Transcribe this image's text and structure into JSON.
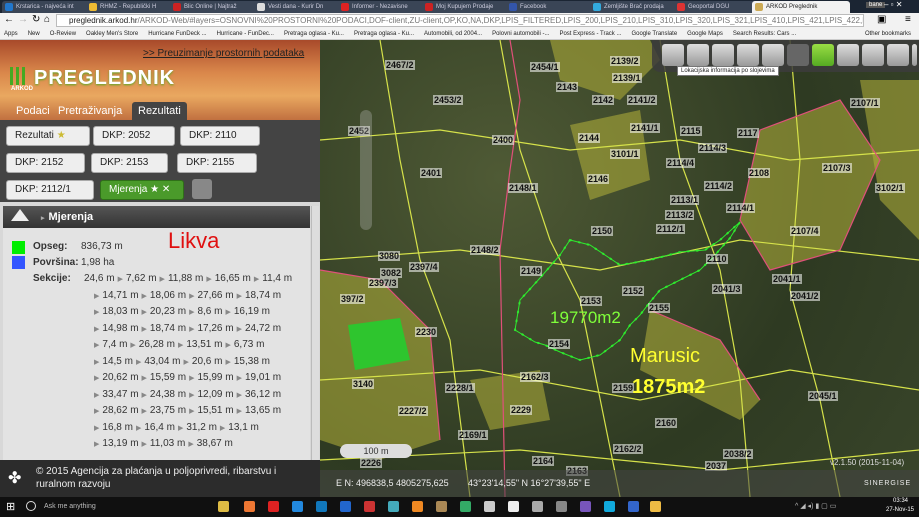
{
  "browser": {
    "tabs": [
      "Krstarica - najveća int",
      "RHMZ - Republički H",
      "Blic Online | Najtraž",
      "Vesti dana - Kurir Dn",
      "Informer - Nezavisne",
      "Moj Kupujem Prodaje",
      "Facebook",
      "Zemljište Brač prodaja",
      "Geoportal DGU",
      "ARKOD Preglednik"
    ],
    "user": "bane",
    "url_host": "preglednik.arkod.hr",
    "url_rest": "/ARKOD-Web/#layers=OSNOVNI%20PROSTORNI%20PODACI,DOF-client,ZU-client,OP,KO,NA,DKP,LPIS_FILTERED,LPIS_200,LPIS_210,LPIS_310,LPIS_320,LPIS_321,LPIS_410,LPIS_421,LPIS_422,LPIS_430,LPIS_450,LPIS_490,LI",
    "bookmarks": [
      "Apps",
      "New",
      "O-Review",
      "Oakley Men's Store",
      "Hurricane FunDeck ...",
      "Hurricane - FunDec...",
      "Pretraga oglasa - Ku...",
      "Pretraga oglasa - Ku...",
      "Automobili, od 2004...",
      "Polovni automobili -...",
      "Post Express - Track ...",
      "Google Translate",
      "Google Maps",
      "Search Results: Cars ...",
      "Other bookmarks"
    ]
  },
  "panel": {
    "download_link": ">> Preuzimanje prostornih podataka",
    "logo": "PREGLEDNIK",
    "logo_sub": "ARKOD",
    "tabs": [
      "Podaci",
      "Pretraživanja",
      "Rezultati"
    ],
    "chips": [
      "Rezultati",
      "DKP: 2052",
      "DKP: 2110",
      "DKP: 2152",
      "DKP: 2153",
      "DKP: 2155",
      "DKP: 2112/1",
      "Mjerenja"
    ],
    "section_title": "Mjerenja",
    "opseg_label": "Opseg:",
    "opseg_value": "836,73 m",
    "povrsina_label": "Površina:",
    "povrsina_value": "1,98 ha",
    "sekcije_label": "Sekcije:",
    "annotation": "Likva",
    "sections": [
      [
        "24,6 m",
        "7,62 m",
        "11,88 m",
        "16,65 m",
        "11,4 m"
      ],
      [
        "14,71 m",
        "18,06 m",
        "27,66 m",
        "18,74 m"
      ],
      [
        "18,03 m",
        "20,23 m",
        "8,6 m",
        "16,19 m"
      ],
      [
        "14,98 m",
        "18,74 m",
        "17,26 m",
        "24,72 m"
      ],
      [
        "7,4 m",
        "26,28 m",
        "13,51 m",
        "6,73 m"
      ],
      [
        "14,5 m",
        "43,04 m",
        "20,6 m",
        "15,38 m"
      ],
      [
        "20,62 m",
        "15,59 m",
        "15,99 m",
        "19,01 m"
      ],
      [
        "33,47 m",
        "24,38 m",
        "12,09 m",
        "36,12 m"
      ],
      [
        "28,62 m",
        "23,75 m",
        "15,51 m",
        "13,65 m"
      ],
      [
        "16,8 m",
        "16,4 m",
        "31,2 m",
        "13,1 m"
      ],
      [
        "13,19 m",
        "11,03 m",
        "38,67 m"
      ]
    ],
    "footer": "© 2015 Agencija za plaćanja u poljoprivredi, ribarstvu i ruralnom razvoju",
    "colors": {
      "perimeter": "#00ee00",
      "area": "#3355ff"
    }
  },
  "map": {
    "tooltip": "Lokacijska informacija po slojevima",
    "scale": "100 m",
    "coords_en": "E N: 496838,5 4805275,625",
    "coords_geo": "43°23'14,55\" N 16°27'39,55\" E",
    "vendor": "SINERGISE",
    "dof_date": "v2.1.50 (2015-11-04)",
    "area_label": "19770m2",
    "owner_label": "Marusic",
    "owner_area": "1875m2",
    "parcels": [
      "2467/2",
      "2454/1",
      "2139/2",
      "2139/1",
      "2453/2",
      "2143",
      "2142",
      "2141/2",
      "2452",
      "2400",
      "2144",
      "2141/1",
      "2115",
      "2117",
      "2114/3",
      "3101/1",
      "2114/4",
      "2108",
      "2401",
      "2146",
      "2148/1",
      "2114/2",
      "2113/1",
      "2114/1",
      "2113/2",
      "2112/1",
      "2150",
      "2107/1",
      "2107/3",
      "3102/1",
      "2107/4",
      "2148/2",
      "3080",
      "2397/4",
      "3082",
      "2397/3",
      "2149",
      "2110",
      "2041/1",
      "2041/3",
      "2152",
      "2041/2",
      "397/2",
      "2153",
      "2155",
      "2230",
      "2154",
      "3140",
      "2162/3",
      "2159",
      "2228/1",
      "2045/1",
      "2227/2",
      "2229",
      "2160",
      "2169/1",
      "2162/2",
      "2164",
      "2163",
      "2038/2",
      "2037",
      "2226"
    ]
  },
  "taskbar": {
    "search": "Ask me anything",
    "time": "03:34",
    "date": "27-Nov-15"
  }
}
